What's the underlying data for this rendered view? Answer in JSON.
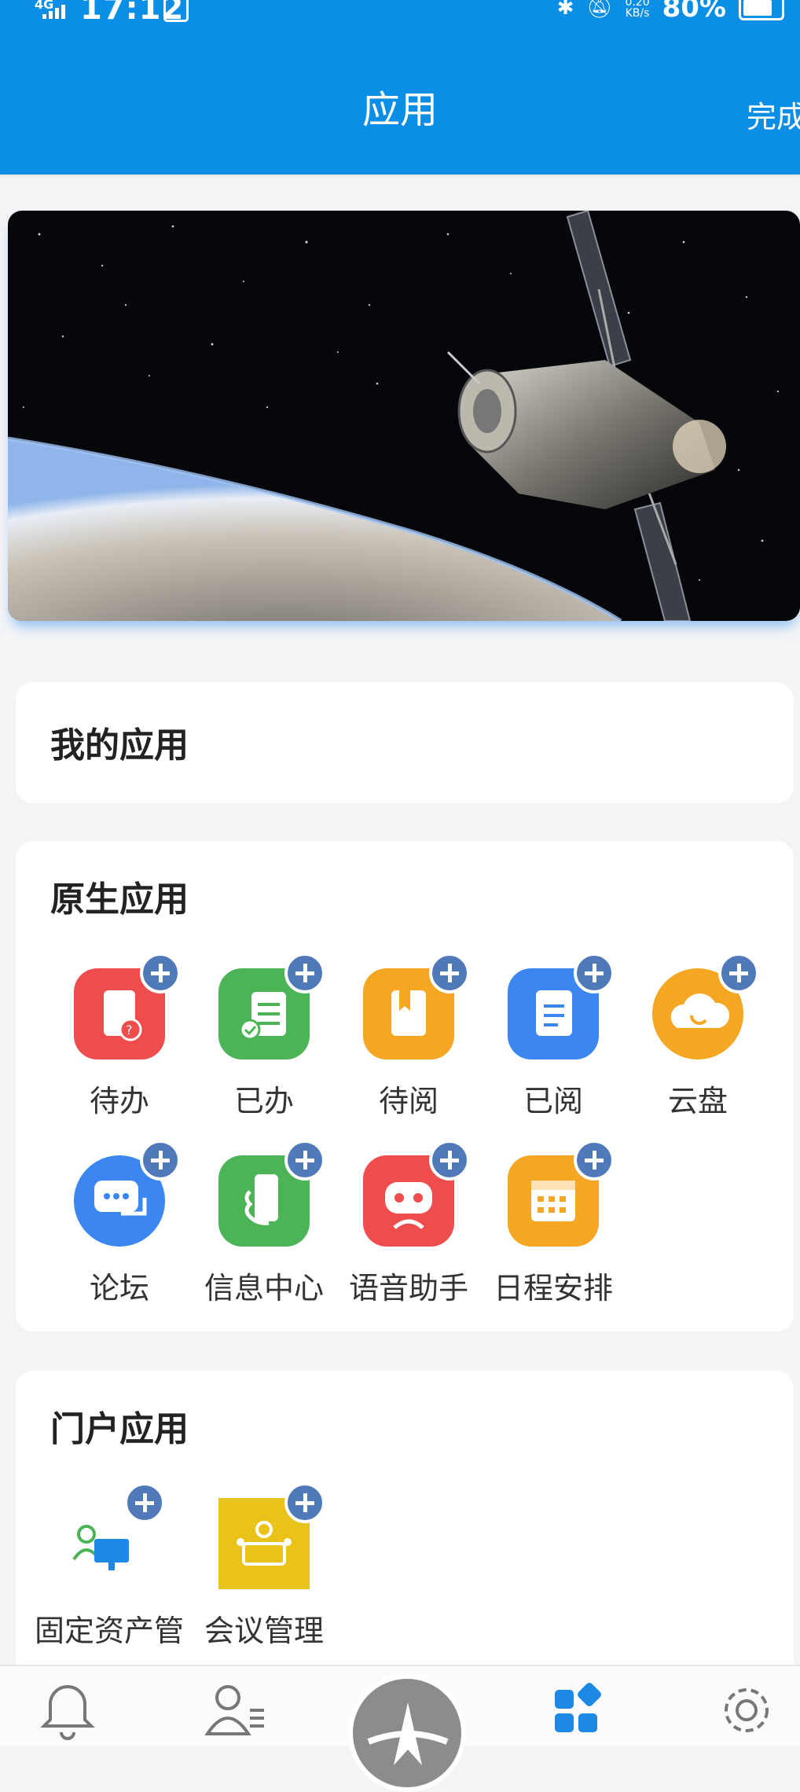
{
  "status_bar": {
    "network": "4G",
    "time": "17:12",
    "speed": "0.20",
    "speed_unit": "KB/s",
    "battery": "80%"
  },
  "header": {
    "title": "应用",
    "done": "完成"
  },
  "banner": {
    "icon": "satellite-over-earth-image"
  },
  "my_apps": {
    "title": "我的应用"
  },
  "native_apps": {
    "title": "原生应用",
    "items": [
      {
        "label": "待办",
        "icon": "todo-doc-icon",
        "color": "#ef4d4d"
      },
      {
        "label": "已办",
        "icon": "done-list-icon",
        "color": "#4cb457"
      },
      {
        "label": "待阅",
        "icon": "book-icon",
        "color": "#f5a623"
      },
      {
        "label": "已阅",
        "icon": "document-icon",
        "color": "#3b86f0"
      },
      {
        "label": "云盘",
        "icon": "cloud-icon",
        "color": "#f5a623"
      },
      {
        "label": "论坛",
        "icon": "chat-icon",
        "color": "#3b86f0"
      },
      {
        "label": "信息中心",
        "icon": "phone-hand-icon",
        "color": "#4cb457"
      },
      {
        "label": "语音助手",
        "icon": "robot-icon",
        "color": "#ef4d4d"
      },
      {
        "label": "日程安排",
        "icon": "calendar-icon",
        "color": "#f5a623"
      }
    ]
  },
  "portal_apps": {
    "title": "门户应用",
    "items": [
      {
        "label": "固定资产管理",
        "icon": "asset-computer-icon",
        "color": "#ffffff"
      },
      {
        "label": "会议管理",
        "icon": "meeting-icon",
        "color": "#e9c31a"
      }
    ]
  },
  "bottom_nav": {
    "items": [
      "bell-icon",
      "contacts-icon",
      "home-logo-icon",
      "apps-grid-icon",
      "settings-gear-icon"
    ],
    "active_color": "#1e88e5"
  }
}
